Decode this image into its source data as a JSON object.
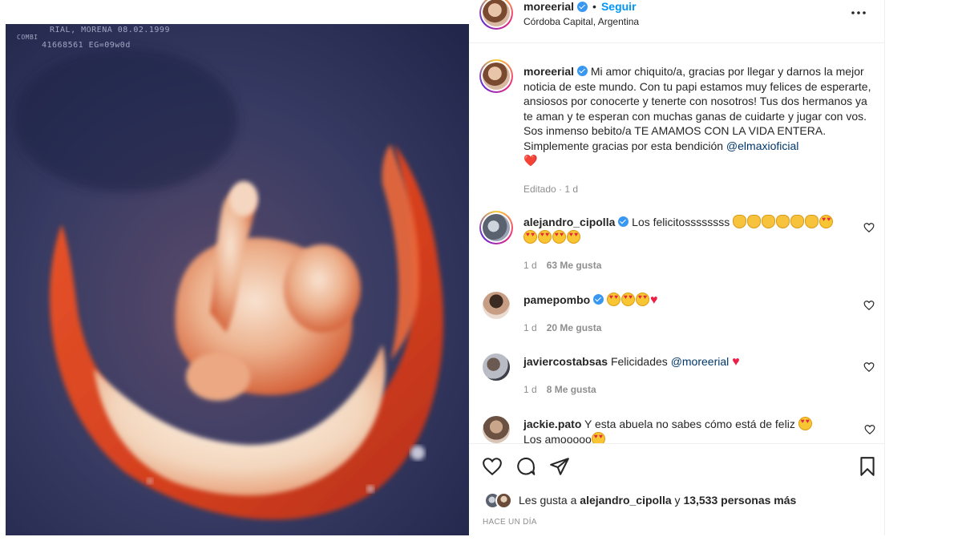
{
  "media": {
    "overlay_line1": "RIAL, MORENA  08.02.1999",
    "overlay_line2": "41668561  EG=09w0d",
    "overlay_left": "COMBI"
  },
  "header": {
    "username": "moreerial",
    "separator": "•",
    "follow_label": "Seguir",
    "location": "Córdoba Capital, Argentina",
    "more_icon": "more-horizontal-icon"
  },
  "caption": {
    "username": "moreerial",
    "text": "Mi amor chiquito/a, gracias por llegar y darnos la mejor noticia de este mundo. Con tu papi estamos muy felices de esperarte, ansiosos por conocerte y tenerte con nosotros! Tus dos hermanos ya te aman y te esperan con muchas ganas de cuidarte y jugar con vos. Sos inmenso bebito/a TE AMAMOS CON LA VIDA ENTERA. Simplemente gracias por esta bendición ",
    "mention": "@elmaxioficial",
    "emoji": "❤️",
    "meta": "Editado · 1 d"
  },
  "comments": [
    {
      "username": "alejandro_cipolla",
      "verified": true,
      "text": "Los felicitossssssss",
      "emojis": "👏👏👏👏👏👏😍😍😍😍😍",
      "time": "1 d",
      "likes": "63 Me gusta"
    },
    {
      "username": "pamepombo",
      "verified": true,
      "text": "",
      "emojis": "😍😍😍❤️",
      "time": "1 d",
      "likes": "20 Me gusta"
    },
    {
      "username": "javiercostabsas",
      "verified": false,
      "text": "Felicidades",
      "mention": "@moreerial",
      "emojis": "❤️",
      "time": "1 d",
      "likes": "8 Me gusta"
    },
    {
      "username": "jackie.pato",
      "verified": false,
      "text": "Y esta abuela no sabes cómo está de feliz",
      "text2": "Los amooooo",
      "emojis": "😍"
    }
  ],
  "actions": {
    "like_icon": "heart-outline-icon",
    "comment_icon": "comment-bubble-icon",
    "share_icon": "paper-plane-icon",
    "save_icon": "bookmark-icon"
  },
  "likes": {
    "prefix": "Les gusta a ",
    "user": "alejandro_cipolla",
    "middle": " y ",
    "count": "13,533 personas más"
  },
  "time_ago": "HACE UN DÍA",
  "colors": {
    "link_blue": "#0095f6",
    "mention_blue": "#00376b",
    "verified_blue": "#3897f0",
    "muted_grey": "#8e8e8e",
    "heart_red": "#ed1e45"
  }
}
